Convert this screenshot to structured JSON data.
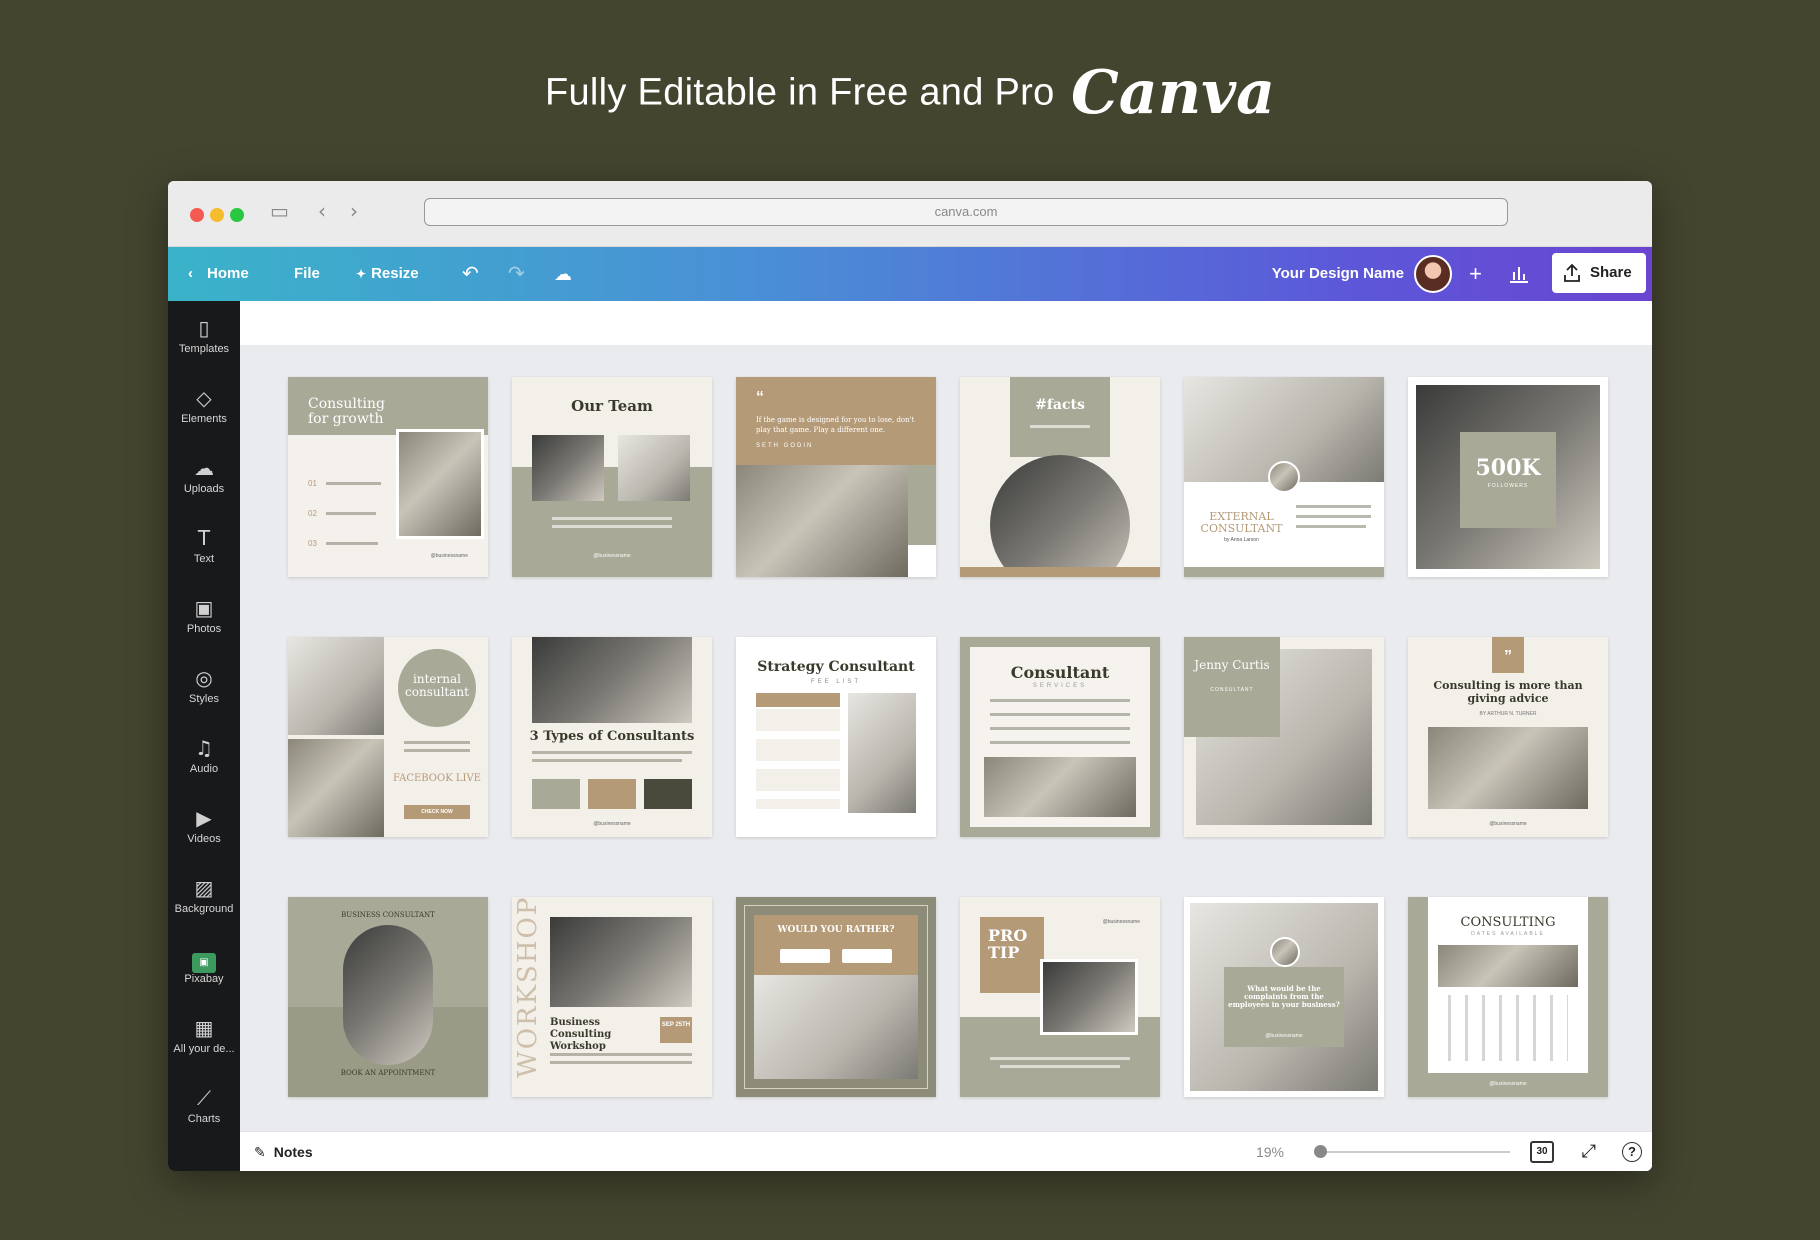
{
  "headline": {
    "text": "Fully Editable in Free and Pro",
    "brand": "Canva"
  },
  "browser": {
    "url": "canva.com"
  },
  "toolbar": {
    "home": "Home",
    "file": "File",
    "resize": "Resize",
    "design_name": "Your Design Name",
    "share": "Share"
  },
  "sidebar": {
    "items": [
      {
        "label": "Templates",
        "icon": "▯"
      },
      {
        "label": "Elements",
        "icon": "◇"
      },
      {
        "label": "Uploads",
        "icon": "☁"
      },
      {
        "label": "Text",
        "icon": "T"
      },
      {
        "label": "Photos",
        "icon": "▣"
      },
      {
        "label": "Styles",
        "icon": "◎"
      },
      {
        "label": "Audio",
        "icon": "♫"
      },
      {
        "label": "Videos",
        "icon": "▶"
      },
      {
        "label": "Background",
        "icon": "▨"
      },
      {
        "label": "Pixabay",
        "icon": "pixabay"
      },
      {
        "label": "All your de...",
        "icon": "▦"
      },
      {
        "label": "Charts",
        "icon": "⟋"
      }
    ]
  },
  "pages": [
    {
      "num": "1",
      "title": "Consulting for growth",
      "sub1": "01",
      "sub2": "02",
      "sub3": "03",
      "handle": "@businessname"
    },
    {
      "num": "2",
      "title": "Our Team",
      "handle": "@businessname"
    },
    {
      "num": "3",
      "title": "If the game is designed for you to lose, don't play that game. Play a different one.",
      "author": "SETH GODIN"
    },
    {
      "num": "4",
      "title": "#facts"
    },
    {
      "num": "5",
      "title": "EXTERNAL CONSULTANT",
      "author": "by Anna Larson"
    },
    {
      "num": "6",
      "title": "500K",
      "sub": "FOLLOWERS"
    },
    {
      "num": "7",
      "title": "internal consultant",
      "sub": "FACEBOOK LIVE",
      "cta": "CHECK NOW"
    },
    {
      "num": "8",
      "title": "3 Types of Consultants",
      "handle": "@businessname"
    },
    {
      "num": "9",
      "title": "Strategy Consultant",
      "sub": "FEE LIST"
    },
    {
      "num": "10",
      "title": "Consultant",
      "sub": "SERVICES"
    },
    {
      "num": "11",
      "title": "Jenny Curtis",
      "sub": "CONSULTANT"
    },
    {
      "num": "12",
      "title": "Consulting is more than giving advice",
      "author": "BY ARTHUR N. TURNER",
      "handle": "@businessname"
    },
    {
      "num": "13",
      "title": "BUSINESS CONSULTANT",
      "sub": "BOOK AN APPOINTMENT"
    },
    {
      "num": "14",
      "title": "Business Consulting Workshop",
      "side": "WORKSHOP",
      "date": "SEP 25TH"
    },
    {
      "num": "15",
      "title": "WOULD YOU RATHER?"
    },
    {
      "num": "16",
      "title": "PRO TIP",
      "handle": "@businessname"
    },
    {
      "num": "17",
      "title": "What would be the complaints from the employees in your business?",
      "handle": "@businessname"
    },
    {
      "num": "18",
      "title": "CONSULTING",
      "sub": "DATES AVAILABLE",
      "handle": "@businessname"
    }
  ],
  "bottombar": {
    "notes": "Notes",
    "zoom": "19%",
    "page_count": "30"
  },
  "colors": {
    "bg": "#44452f",
    "sage": "#a8a996",
    "tan": "#b59a78"
  }
}
